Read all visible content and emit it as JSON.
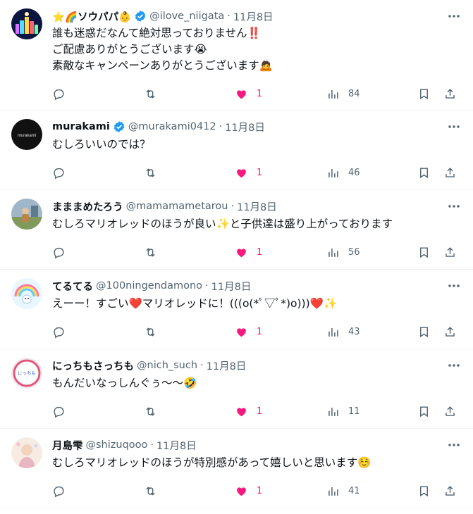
{
  "tweets": [
    {
      "name": "⭐🌈ソウパパ👶",
      "verified": true,
      "handle": "@ilove_niigata",
      "dot": "·",
      "date": "11月8日",
      "text": "誰も迷惑だなんて絶対思っておりません‼️\nご配慮ありがとうございます😭\n素敵なキャンペーンありがとうございます🙇",
      "likes": "1",
      "views": "84",
      "avatar": "night-city-lights"
    },
    {
      "name": "murakami",
      "verified": true,
      "handle": "@murakami0412",
      "dot": "·",
      "date": "11月8日",
      "text": "むしろいいのでは？",
      "likes": "1",
      "views": "46",
      "avatar": "murakami-logo",
      "avatar_text": "murakami"
    },
    {
      "name": "まままめたろう",
      "verified": false,
      "handle": "@mamamametarou",
      "dot": "·",
      "date": "11月8日",
      "text": "むしろマリオレッドのほうが良い✨と子供達は盛り上がっております",
      "likes": "1",
      "views": "56",
      "avatar": "child-outdoor-photo"
    },
    {
      "name": "てるてる",
      "verified": false,
      "handle": "@100ningendamono",
      "dot": "·",
      "date": "11月8日",
      "text": "えーー！すごい❤️マリオレッドに！(((o(*ﾟ▽ﾟ*)o)))❤️✨",
      "likes": "1",
      "views": "43",
      "avatar": "rainbow-character"
    },
    {
      "name": "にっちもさっちも",
      "verified": false,
      "handle": "@nich_such",
      "dot": "·",
      "date": "11月8日",
      "text": "もんだいなっしんぐぅ〜〜🤣",
      "likes": "1",
      "views": "11",
      "avatar": "nicchimo-badge",
      "avatar_text": "にっちも"
    },
    {
      "name": "月島雫",
      "verified": false,
      "handle": "@shizuqooo",
      "dot": "·",
      "date": "11月8日",
      "text": "むしろマリオレッドのほうが特別感があって嬉しいと思います☺️",
      "likes": "1",
      "views": "41",
      "avatar": "soft-illustration"
    }
  ],
  "colors": {
    "like": "#f91880",
    "muted": "#536471",
    "verified": "#1d9bf0",
    "border": "#eff3f4"
  },
  "icons": [
    "more-icon",
    "reply-icon",
    "retweet-icon",
    "heart-icon",
    "views-icon",
    "bookmark-icon",
    "share-icon",
    "verified-badge-icon"
  ]
}
